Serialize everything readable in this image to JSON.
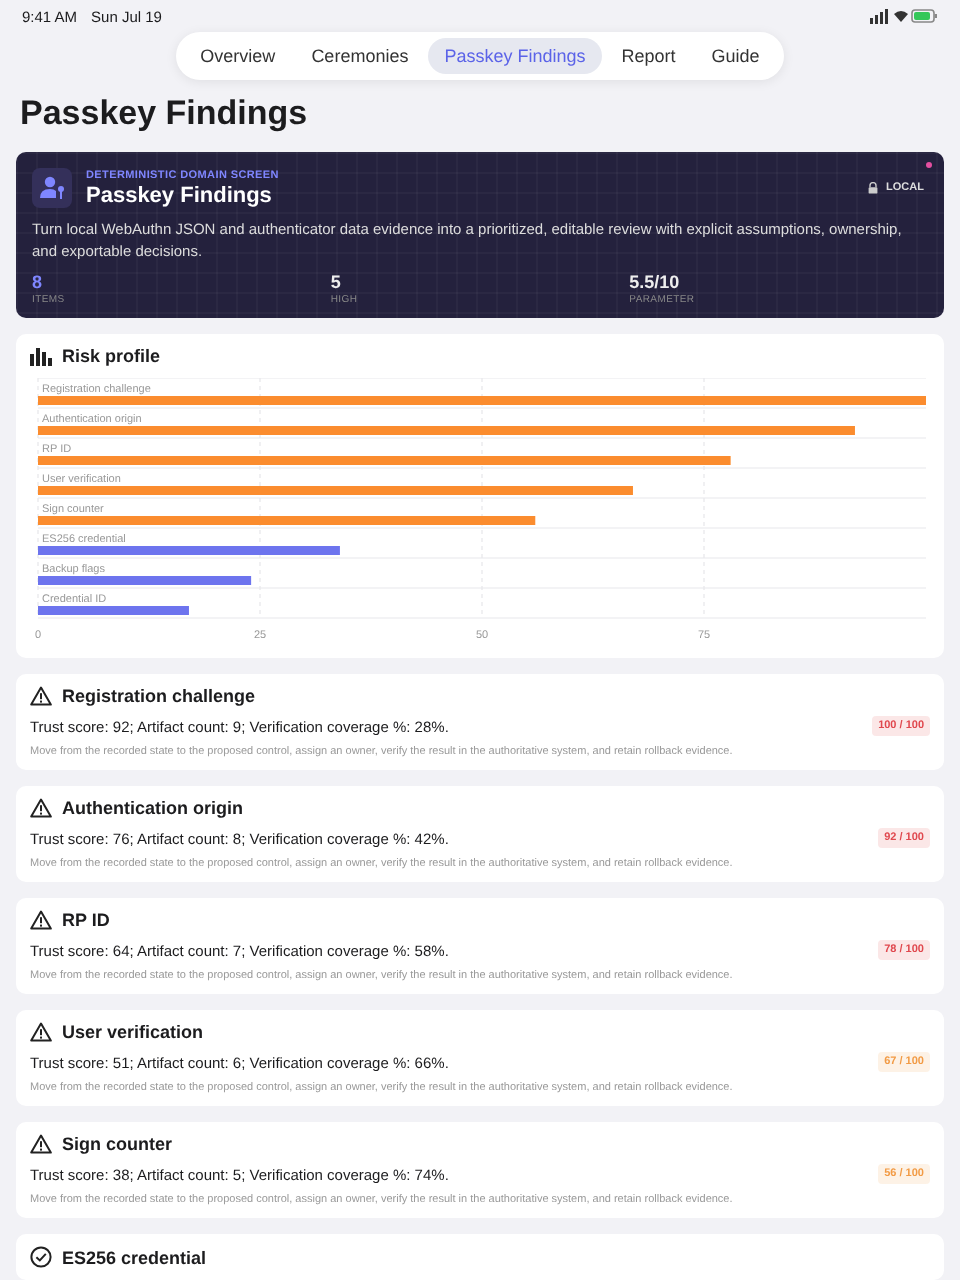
{
  "status_bar": {
    "time": "9:41 AM",
    "date": "Sun Jul 19"
  },
  "tabs": [
    {
      "label": "Overview",
      "selected": false
    },
    {
      "label": "Ceremonies",
      "selected": false
    },
    {
      "label": "Passkey Findings",
      "selected": true
    },
    {
      "label": "Report",
      "selected": false
    },
    {
      "label": "Guide",
      "selected": false
    }
  ],
  "page_title": "Passkey Findings",
  "hero": {
    "eyebrow": "DETERMINISTIC DOMAIN SCREEN",
    "title": "Passkey Findings",
    "badge": "LOCAL",
    "description": "Turn local WebAuthn JSON and authenticator data evidence into a prioritized, editable review with explicit assumptions, ownership, and exportable decisions.",
    "stats": [
      {
        "value": "8",
        "label": "ITEMS",
        "accent": true
      },
      {
        "value": "5",
        "label": "HIGH",
        "accent": false
      },
      {
        "value": "5.5/10",
        "label": "PARAMETER",
        "accent": false
      }
    ]
  },
  "risk_profile": {
    "title": "Risk profile",
    "chart_data": {
      "type": "bar",
      "orientation": "horizontal",
      "grid": true,
      "categories": [
        "Registration challenge",
        "Authentication origin",
        "RP ID",
        "User verification",
        "Sign counter",
        "ES256 credential",
        "Backup flags",
        "Credential ID"
      ],
      "series": [
        {
          "color": "#fb8c2e",
          "values": [
            100,
            92,
            78,
            67,
            56,
            null,
            null,
            null
          ]
        },
        {
          "color": "#6d74ee",
          "values": [
            null,
            null,
            null,
            null,
            null,
            34,
            24,
            17
          ]
        }
      ],
      "xlim": [
        0,
        100
      ],
      "xticks": [
        0,
        25,
        50,
        75
      ]
    }
  },
  "findings": [
    {
      "kind": "warning",
      "title": "Registration challenge",
      "detail": "Trust score: 92; Artifact count: 9; Verification coverage %: 28%.",
      "score": "100 / 100",
      "color": "#e0484e",
      "note": "Move from the recorded state to the proposed control, assign an owner, verify the result in the authoritative system, and retain rollback evidence."
    },
    {
      "kind": "warning",
      "title": "Authentication origin",
      "detail": "Trust score: 76; Artifact count: 8; Verification coverage %: 42%.",
      "score": "92 / 100",
      "color": "#e0484e",
      "note": "Move from the recorded state to the proposed control, assign an owner, verify the result in the authoritative system, and retain rollback evidence."
    },
    {
      "kind": "warning",
      "title": "RP ID",
      "detail": "Trust score: 64; Artifact count: 7; Verification coverage %: 58%.",
      "score": "78 / 100",
      "color": "#e0484e",
      "note": "Move from the recorded state to the proposed control, assign an owner, verify the result in the authoritative system, and retain rollback evidence."
    },
    {
      "kind": "warning",
      "title": "User verification",
      "detail": "Trust score: 51; Artifact count: 6; Verification coverage %: 66%.",
      "score": "67 / 100",
      "color": "#f29b45",
      "note": "Move from the recorded state to the proposed control, assign an owner, verify the result in the authoritative system, and retain rollback evidence."
    },
    {
      "kind": "warning",
      "title": "Sign counter",
      "detail": "Trust score: 38; Artifact count: 5; Verification coverage %: 74%.",
      "score": "56 / 100",
      "color": "#f29b45",
      "note": "Move from the recorded state to the proposed control, assign an owner, verify the result in the authoritative system, and retain rollback evidence."
    },
    {
      "kind": "ok",
      "title": "ES256 credential"
    }
  ]
}
